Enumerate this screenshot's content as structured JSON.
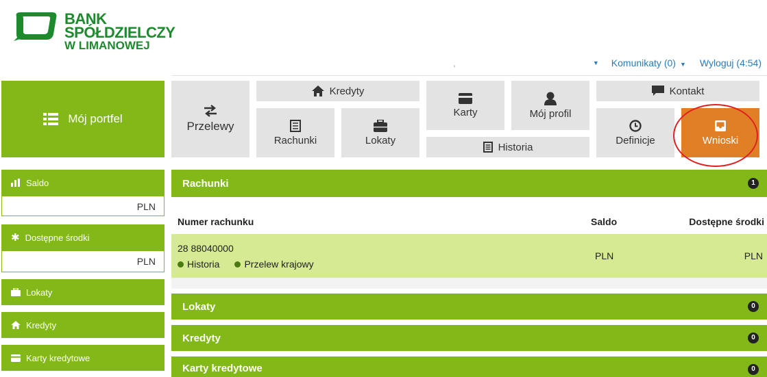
{
  "header": {
    "bank_line1": "BANK SPÓŁDZIELCZY",
    "bank_line2": "W LIMANOWEJ",
    "brand_green": "#1e8a2e",
    "top_dot": ",",
    "komunikaty": "Komunikaty (0)",
    "wyloguj": "Wyloguj (4:54)"
  },
  "nav": {
    "portfel": "Mój portfel",
    "przelewy": "Przelewy",
    "kredyty": "Kredyty",
    "rachunki": "Rachunki",
    "lokaty": "Lokaty",
    "karty": "Karty",
    "historia": "Historia",
    "moj_profil": "Mój profil",
    "kontakt": "Kontakt",
    "definicje": "Definicje",
    "wnioski": "Wnioski",
    "accent_green": "#82b919",
    "accent_orange": "#e07f26"
  },
  "sidebar": {
    "saldo": "Saldo",
    "saldo_value": "PLN",
    "dostepne": "Dostępne środki",
    "dostepne_value": "PLN",
    "lokaty": "Lokaty",
    "kredyty": "Kredyty",
    "karty_kredytowe": "Karty kredytowe"
  },
  "main": {
    "rachunki_title": "Rachunki",
    "rachunki_count": "1",
    "columns": [
      "Numer rachunku",
      "Saldo",
      "Dostępne środki"
    ],
    "account_number": "28 88040000",
    "link_historia": "Historia",
    "link_przelew": "Przelew krajowy",
    "saldo_value": "PLN",
    "dostepne_value": "PLN",
    "lokaty_title": "Lokaty",
    "lokaty_count": "0",
    "kredyty_title": "Kredyty",
    "kredyty_count": "0",
    "karty_title": "Karty kredytowe",
    "karty_count": "0"
  }
}
